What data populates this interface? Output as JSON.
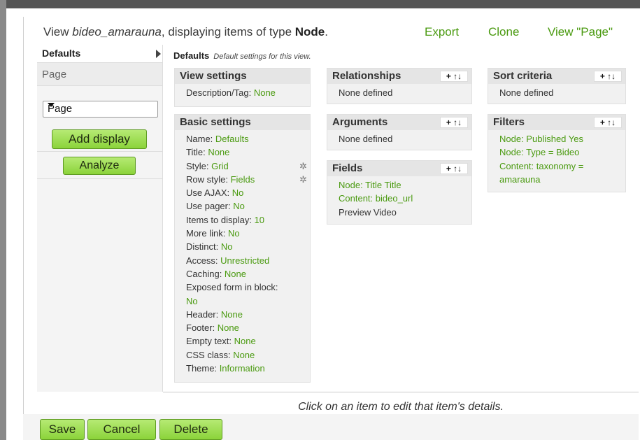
{
  "header": {
    "title_prefix": "View ",
    "view_name": "bideo_amarauna",
    "title_mid": ", displaying items of type ",
    "node_type": "Node",
    "title_suffix": ".",
    "export": "Export",
    "clone": "Clone",
    "view_page": "View \"Page\""
  },
  "tabs": {
    "defaults": "Defaults",
    "page": "Page",
    "display_select": "Page",
    "add_display": "Add display",
    "analyze": "Analyze"
  },
  "main": {
    "heading": "Defaults",
    "subheading": "Default settings for this view."
  },
  "view_settings": {
    "title": "View settings",
    "items": [
      {
        "label": "Description/Tag: ",
        "value": "None"
      }
    ]
  },
  "basic_settings": {
    "title": "Basic settings",
    "items": [
      {
        "label": "Name: ",
        "value": "Defaults"
      },
      {
        "label": "Title: ",
        "value": "None"
      },
      {
        "label": "Style: ",
        "value": "Grid"
      },
      {
        "label": "Row style: ",
        "value": "Fields"
      },
      {
        "label": "Use AJAX: ",
        "value": "No"
      },
      {
        "label": "Use pager: ",
        "value": "No"
      },
      {
        "label": "Items to display: ",
        "value": "10"
      },
      {
        "label": "More link: ",
        "value": "No"
      },
      {
        "label": "Distinct: ",
        "value": "No"
      },
      {
        "label": "Access: ",
        "value": "Unrestricted"
      },
      {
        "label": "Caching: ",
        "value": "None"
      },
      {
        "label": "Exposed form in block: ",
        "value": ""
      },
      {
        "label": "",
        "value": "No"
      },
      {
        "label": "Header: ",
        "value": "None"
      },
      {
        "label": "Footer: ",
        "value": "None"
      },
      {
        "label": "Empty text: ",
        "value": "None"
      },
      {
        "label": "CSS class: ",
        "value": "None"
      },
      {
        "label": "Theme: ",
        "value": "Information"
      }
    ]
  },
  "relationships": {
    "title": "Relationships",
    "empty": "None defined"
  },
  "arguments": {
    "title": "Arguments",
    "empty": "None defined"
  },
  "fields": {
    "title": "Fields",
    "items": [
      "Node: Title Title",
      "Content: bideo_url",
      "Preview Video"
    ]
  },
  "sort_criteria": {
    "title": "Sort criteria",
    "empty": "None defined"
  },
  "filters": {
    "title": "Filters",
    "items": [
      "Node: Published Yes",
      "Node: Type = Bideo",
      "Content: taxonomy =",
      "amarauna"
    ]
  },
  "controls": {
    "add": "+",
    "rearrange": "↑↓"
  },
  "footer_message": "Click on an item to edit that item's details.",
  "buttons": {
    "save": "Save",
    "cancel": "Cancel",
    "delete": "Delete"
  }
}
